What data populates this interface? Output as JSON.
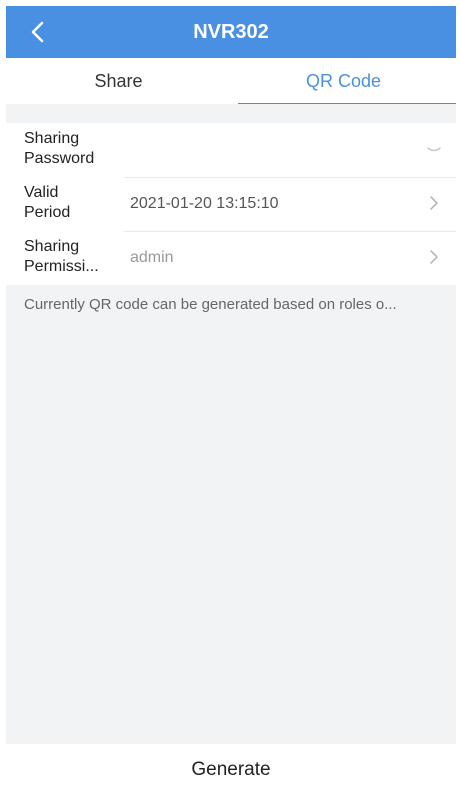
{
  "header": {
    "title": "NVR302"
  },
  "tabs": [
    {
      "label": "Share"
    },
    {
      "label": "QR Code"
    }
  ],
  "form": {
    "rows": [
      {
        "label_line1": "Sharing",
        "label_line2": "Password",
        "value": ""
      },
      {
        "label_line1": "Valid",
        "label_line2": "Period",
        "value": "2021-01-20 13:15:10"
      },
      {
        "label_line1": "Sharing",
        "label_line2": "Permissi...",
        "value": "admin"
      }
    ]
  },
  "hint": "Currently QR code can be generated based on roles o...",
  "generate_label": "Generate",
  "colors": {
    "accent": "#4a90e2",
    "background": "#f2f3f5"
  },
  "icons": {
    "back": "chevron-left-icon",
    "dropdown": "chevron-down-icon",
    "next": "chevron-right-icon"
  }
}
